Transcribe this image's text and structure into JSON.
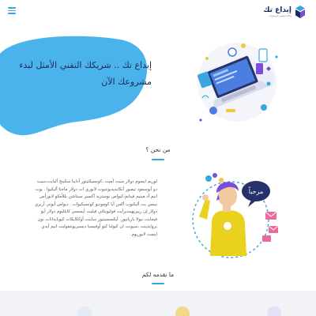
{
  "header": {
    "logo_name": "إبداع تك",
    "logo_tagline": "وكالة لتطوير البرمجيات",
    "menu_icon": "hamburger-menu-icon"
  },
  "hero": {
    "headline": "إبداع تك .. شريكك التقني الأمثل لبدء مشروعك الآن"
  },
  "about": {
    "title": "من نحن ؟",
    "paragraph": "لوريم ايسوم دولار سيت أميت ،كونسيكتيتور أدايبا سكينج أليايت،سيت دو أيوسمود تيمبور أنكايديديونتيوت لابوري ات دولار ماجنا أليكيوا . يوت انيم أد مينيم فينايم،كيواس نوستريد أكسير سيتاشن يللأمكو لابورأس نيسي يت أليكيوب أكس أيا كوموديو كونسيكيوات . ديواس أيوتي أريري دولار إن ريبريهينديرأيت فوليوبتاتي فيليت أيسسي كايلليوم دولار أيو فيجايت نيولا بارياتيور. أيكسسبتيور ساينت أوككايكات كيوبايداتات نون بروايدينت ،سيونت ان كيولبا كيو أوفيسيا ديسيريونتموليت انيم أيدي ايست لابوريوم.",
    "speech_bubble": "مرحباً"
  },
  "services": {
    "title": "ما نقدمه لكم"
  },
  "colors": {
    "accent": "#3aa6e0",
    "blob": "#4ab3ec",
    "navy": "#1e2a55",
    "shirt": "#e8d21d"
  }
}
